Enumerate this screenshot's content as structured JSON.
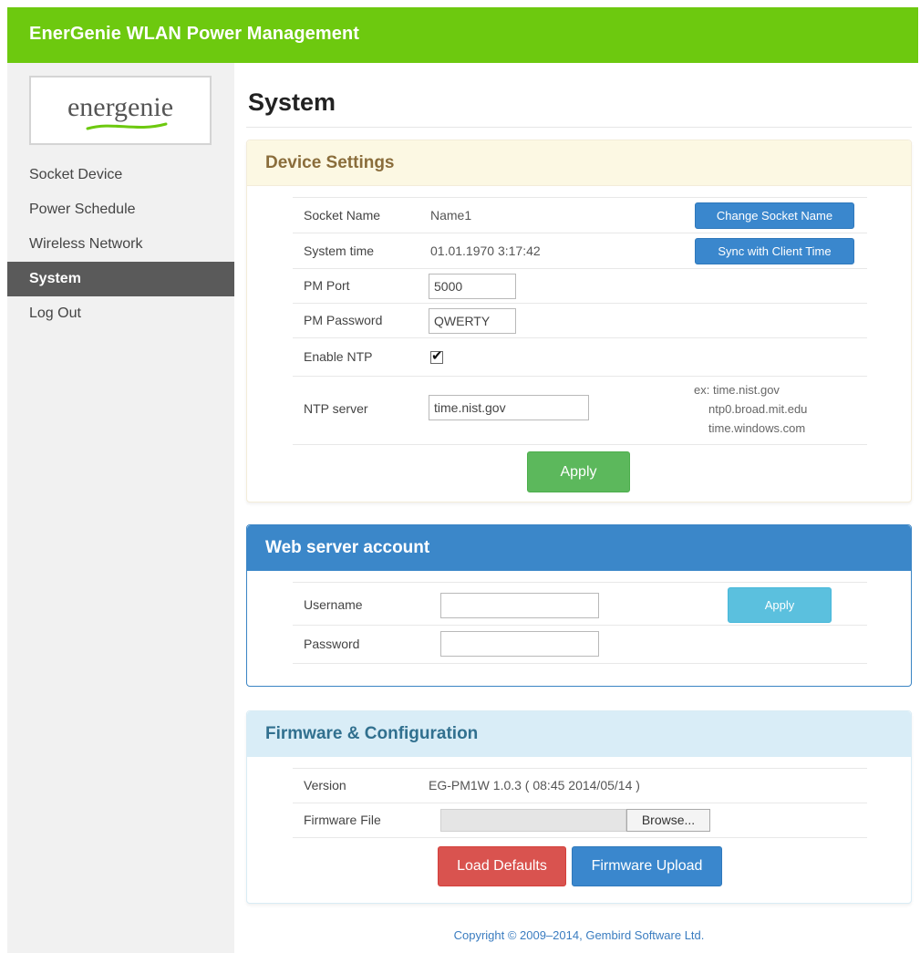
{
  "app": {
    "title": "EnerGenie WLAN Power Management"
  },
  "logo": {
    "text": "energenie"
  },
  "nav": {
    "items": [
      {
        "label": "Socket Device"
      },
      {
        "label": "Power Schedule"
      },
      {
        "label": "Wireless Network"
      },
      {
        "label": "System"
      },
      {
        "label": "Log Out"
      }
    ],
    "active": "System"
  },
  "page": {
    "title": "System"
  },
  "device_settings": {
    "heading": "Device Settings",
    "socket_name_label": "Socket Name",
    "socket_name_value": "Name1",
    "change_socket_name_button": "Change Socket Name",
    "system_time_label": "System time",
    "system_time_value": "01.01.1970 3:17:42",
    "sync_button": "Sync with Client Time",
    "pm_port_label": "PM Port",
    "pm_port_value": "5000",
    "pm_password_label": "PM Password",
    "pm_password_value": "QWERTY",
    "enable_ntp_label": "Enable NTP",
    "enable_ntp_checked": true,
    "ntp_server_label": "NTP server",
    "ntp_server_value": "time.nist.gov",
    "ntp_hint_1": "ex: time.nist.gov",
    "ntp_hint_2": "ntp0.broad.mit.edu",
    "ntp_hint_3": "time.windows.com",
    "apply_button": "Apply"
  },
  "web_server_account": {
    "heading": "Web server account",
    "username_label": "Username",
    "username_value": "",
    "password_label": "Password",
    "password_value": "",
    "apply_button": "Apply"
  },
  "firmware": {
    "heading": "Firmware & Configuration",
    "version_label": "Version",
    "version_value": "EG-PM1W 1.0.3 ( 08:45 2014/05/14 )",
    "firmware_file_label": "Firmware File",
    "browse_button": "Browse...",
    "load_defaults_button": "Load Defaults",
    "firmware_upload_button": "Firmware Upload"
  },
  "footer": {
    "copyright": "Copyright © 2009–2014, Gembird Software Ltd."
  },
  "colors": {
    "topbar": "#6dc90f",
    "nav_active": "#5a5a5a",
    "btn_blue": "#3a87cd",
    "btn_green": "#5cb85c",
    "btn_cyan": "#5bc0de",
    "btn_red": "#d9534f"
  }
}
